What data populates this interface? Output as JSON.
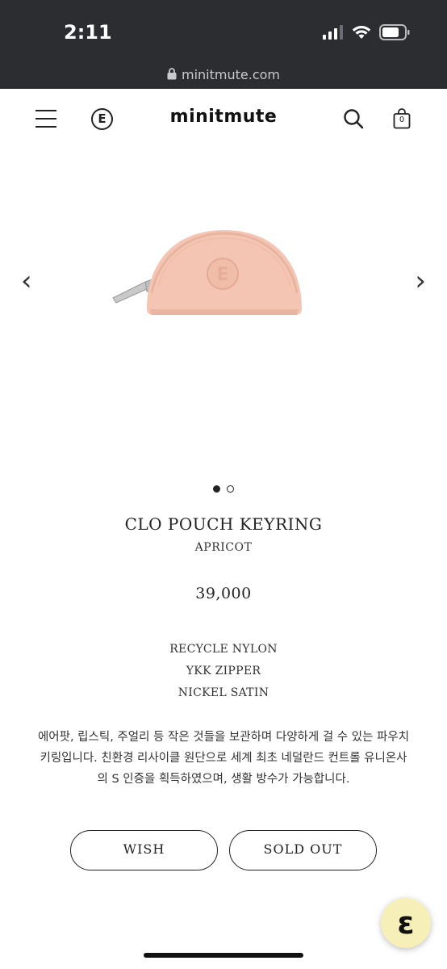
{
  "status_bar": {
    "time": "2:11",
    "url": "minitmute.com",
    "icons": [
      "signal-icon",
      "wifi-icon",
      "battery-icon",
      "lock-icon"
    ]
  },
  "header": {
    "brand": "minitmute",
    "logo_letter": "E",
    "cart_count": "0",
    "icons": [
      "menu-icon",
      "logo-icon",
      "search-icon",
      "cart-icon"
    ]
  },
  "carousel": {
    "slide_count": 2,
    "active_slide": 1,
    "image_color": "#f4c5b2"
  },
  "product": {
    "title": "CLO POUCH KEYRING",
    "color": "APRICOT",
    "price": "39,000",
    "specs": [
      "RECYCLE NYLON",
      "YKK ZIPPER",
      "NICKEL SATIN"
    ],
    "description": "에어팟, 립스틱, 주얼리 등 작은 것들을 보관하며 다양하게 걸 수 있는 파우치 키링입니다. 친환경 리사이클 원단으로 세계 최초 네덜란드 컨트롤 유니온사의 S 인증을 획득하였으며, 생활 방수가 가능합니다."
  },
  "actions": {
    "wish_label": "WISH",
    "soldout_label": "SOLD OUT"
  },
  "fab": {
    "letter": "ɛ",
    "bg_color": "#f6f0b8"
  }
}
